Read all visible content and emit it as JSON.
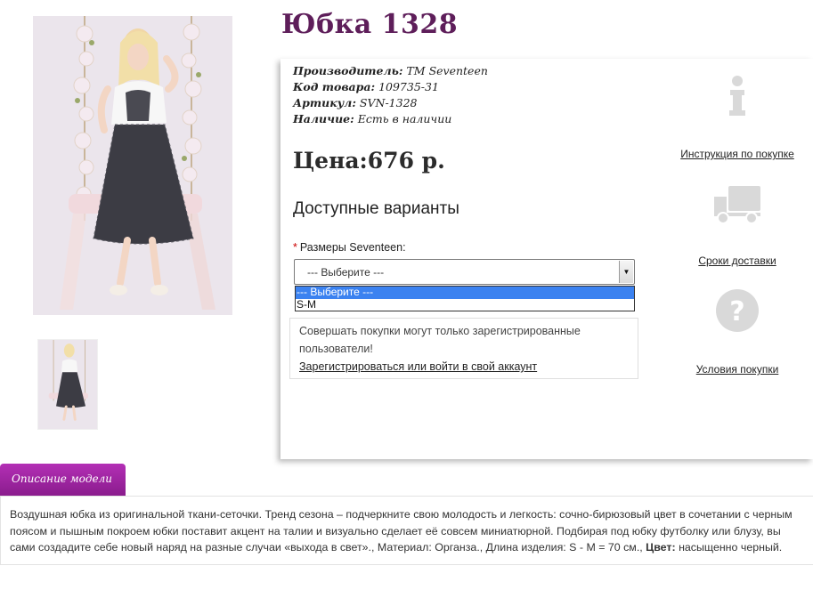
{
  "product": {
    "title": "Юбка 1328",
    "manufacturer_label": "Производитель:",
    "manufacturer_value": "TM Seventeen",
    "code_label": "Код товара:",
    "code_value": "109735-31",
    "sku_label": "Артикул:",
    "sku_value": "SVN-1328",
    "stock_label": "Наличие:",
    "stock_value": "Есть в наличии",
    "price": "Цена:676 р."
  },
  "options": {
    "heading": "Доступные варианты",
    "required_mark": "*",
    "size_label": "Размеры Seventeen:",
    "select_value": "--- Выберите ---",
    "dropdown_options": [
      "--- Выберите ---",
      "S-M"
    ],
    "highlight_color": "#3b82f0"
  },
  "notice": {
    "text": "Совершать покупки могут только зарегистрированные пользователи!",
    "link": "Зарегистрироваться или войти в свой аккаунт"
  },
  "sidebar": {
    "instructions": "Инструкция по покупке",
    "delivery": "Сроки доставки",
    "terms": "Условия покупки",
    "icons": [
      "info-icon",
      "truck-icon",
      "question-icon"
    ]
  },
  "description": {
    "tab_label": "Описание модели",
    "text": "Воздушная юбка из оригинальной ткани-сеточки. Тренд сезона – подчеркните свою молодость и легкость: сочно-бирюзовый цвет в сочетании с черным поясом и пышным покроем юбки поставит акцент на талии и визуально сделает её совсем миниатюрной. Подбирая под юбку футболку или блузу, вы сами создадите себе новый наряд на разные случаи «выхода в свет».,",
    "material_label": "Материал:",
    "material_value": "Органза.,",
    "length_label": "Длина изделия:",
    "length_value": "S - M = 70 см.,",
    "color_label": "Цвет:",
    "color_value": "насыщенно черный."
  },
  "colors": {
    "title": "#5e1e5a",
    "tab": "#9e24a1"
  }
}
